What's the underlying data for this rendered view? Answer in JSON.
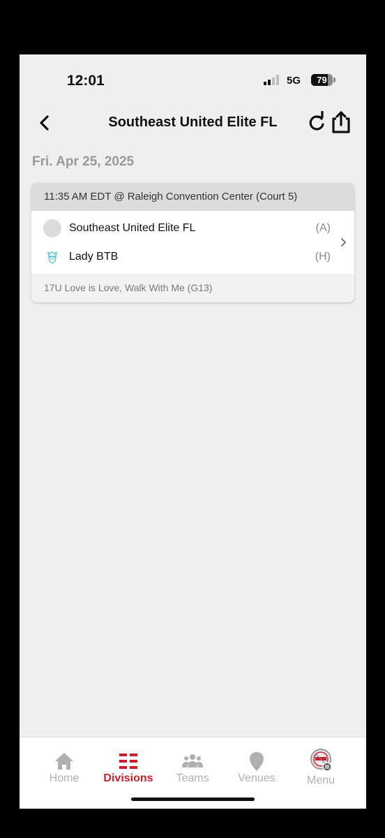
{
  "status_bar": {
    "time": "12:01",
    "network": "5G",
    "battery": "79",
    "battery_level": 0.79
  },
  "header": {
    "title": "Southeast United Elite FL"
  },
  "date_heading": "Fri. Apr 25, 2025",
  "game": {
    "time_venue": "11:35 AM EDT @ Raleigh Convention Center (Court 5)",
    "away_team": {
      "name": "Southeast United Elite FL",
      "side": "(A)"
    },
    "home_team": {
      "name": "Lady BTB",
      "side": "(H)"
    },
    "division": "17U Love is Love, Walk With Me (G13)"
  },
  "nav": [
    {
      "label": "Home",
      "icon": "home-icon",
      "active": false
    },
    {
      "label": "Divisions",
      "icon": "divisions-icon",
      "active": true
    },
    {
      "label": "Teams",
      "icon": "teams-icon",
      "active": false
    },
    {
      "label": "Venues",
      "icon": "venue-pin-icon",
      "active": false
    },
    {
      "label": "Menu",
      "icon": "menu-logo-icon",
      "active": false
    }
  ],
  "colors": {
    "accent": "#cc1f2c",
    "inactive": "#b0b0b0",
    "background": "#efefef"
  }
}
